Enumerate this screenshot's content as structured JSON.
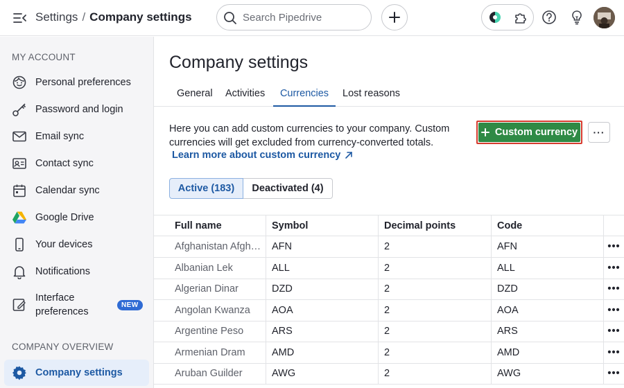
{
  "topbar": {
    "breadcrumb_root": "Settings",
    "breadcrumb_sep": "/",
    "breadcrumb_current": "Company settings",
    "search_placeholder": "Search Pipedrive"
  },
  "sidebar": {
    "section_account": "MY ACCOUNT",
    "section_company": "COMPANY OVERVIEW",
    "items": [
      {
        "label": "Personal preferences",
        "icon": "smiley-icon"
      },
      {
        "label": "Password and login",
        "icon": "key-icon"
      },
      {
        "label": "Email sync",
        "icon": "envelope-icon"
      },
      {
        "label": "Contact sync",
        "icon": "contact-card-icon"
      },
      {
        "label": "Calendar sync",
        "icon": "calendar-icon"
      },
      {
        "label": "Google Drive",
        "icon": "google-drive-icon"
      },
      {
        "label": "Your devices",
        "icon": "phone-icon"
      },
      {
        "label": "Notifications",
        "icon": "bell-icon"
      },
      {
        "label": "Interface preferences",
        "icon": "interface-edit-icon",
        "badge": "NEW"
      },
      {
        "label": "Company settings",
        "icon": "gear-icon",
        "active": true
      }
    ]
  },
  "main": {
    "title": "Company settings",
    "tabs": [
      "General",
      "Activities",
      "Currencies",
      "Lost reasons"
    ],
    "active_tab": "Currencies",
    "description": "Here you can add custom currencies to your company. Custom currencies will get excluded from currency-converted totals.",
    "learn_more": "Learn more about custom currency",
    "add_button": "Custom currency",
    "more_button": "···",
    "filters": [
      "Active (183)",
      "Deactivated (4)"
    ],
    "table": {
      "columns": [
        "Full name",
        "Symbol",
        "Decimal points",
        "Code"
      ],
      "rows": [
        [
          "Afghanistan Afgh…",
          "AFN",
          "2",
          "AFN"
        ],
        [
          "Albanian Lek",
          "ALL",
          "2",
          "ALL"
        ],
        [
          "Algerian Dinar",
          "DZD",
          "2",
          "DZD"
        ],
        [
          "Angolan Kwanza",
          "AOA",
          "2",
          "AOA"
        ],
        [
          "Argentine Peso",
          "ARS",
          "2",
          "ARS"
        ],
        [
          "Armenian Dram",
          "AMD",
          "2",
          "AMD"
        ],
        [
          "Aruban Guilder",
          "AWG",
          "2",
          "AWG"
        ]
      ],
      "row_action": "•••"
    }
  },
  "colors": {
    "accent": "#1d59a3",
    "primary_button": "#2f8a45",
    "highlight_border": "#d63a2e",
    "sidebar_bg": "#f5f5f7"
  }
}
